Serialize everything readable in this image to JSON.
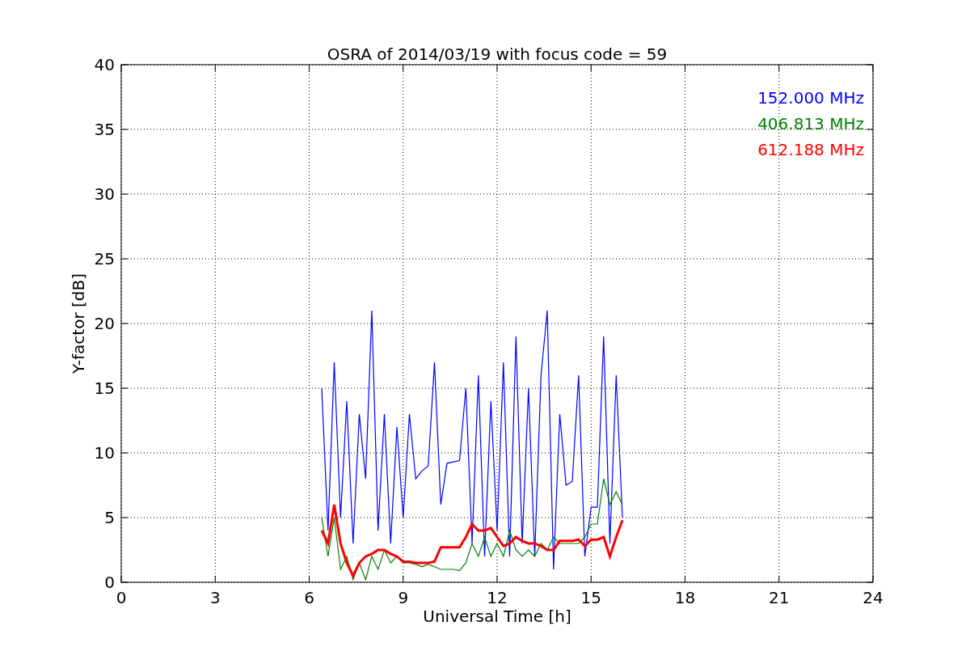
{
  "chart_data": {
    "type": "line",
    "title": "OSRA of 2014/03/19 with focus code = 59",
    "xlabel": "Universal Time [h]",
    "ylabel": "Y-factor [dB]",
    "x": [
      6.4,
      6.6,
      6.8,
      7.0,
      7.2,
      7.4,
      7.6,
      7.8,
      8.0,
      8.2,
      8.4,
      8.6,
      8.8,
      9.0,
      9.2,
      9.4,
      9.6,
      9.8,
      10.0,
      10.2,
      10.4,
      10.6,
      10.8,
      11.0,
      11.2,
      11.4,
      11.6,
      11.8,
      12.0,
      12.2,
      12.4,
      12.6,
      12.8,
      13.0,
      13.2,
      13.4,
      13.6,
      13.8,
      14.0,
      14.2,
      14.4,
      14.6,
      14.8,
      15.0,
      15.2,
      15.4,
      15.6,
      15.8,
      16.0
    ],
    "series": [
      {
        "name": "152.000 MHz",
        "color": "#0000ff",
        "values": [
          15,
          4,
          17,
          5,
          14,
          3,
          13,
          8,
          21,
          4,
          13,
          3,
          12,
          5,
          13,
          8,
          8.6,
          9,
          17,
          6,
          9.2,
          9.3,
          9.4,
          15,
          3,
          16,
          2,
          14,
          4,
          17,
          2,
          19,
          3,
          15,
          2,
          16,
          21,
          1,
          13,
          7.5,
          7.8,
          16,
          2,
          5.8,
          5.8,
          19,
          3,
          16,
          5
        ]
      },
      {
        "name": "406.813 MHz",
        "color": "#008000",
        "values": [
          5,
          2,
          5,
          1,
          2,
          0.2,
          1.5,
          0.2,
          2,
          1,
          2.5,
          1.5,
          2,
          1.5,
          1.5,
          1.4,
          1.2,
          1.4,
          1.2,
          1,
          1,
          1,
          0.9,
          1.5,
          3,
          2,
          3.5,
          2,
          3,
          2,
          4,
          2.5,
          2,
          2.5,
          2,
          3,
          2.5,
          3.5,
          3,
          3,
          3,
          3,
          3.5,
          4.5,
          4.5,
          8,
          6,
          7,
          6
        ]
      },
      {
        "name": "612.188 MHz",
        "color": "#ff0000",
        "values": [
          4,
          3,
          6,
          3,
          1.5,
          0.5,
          1.5,
          2,
          2.2,
          2.5,
          2.5,
          2.2,
          2,
          1.6,
          1.6,
          1.5,
          1.5,
          1.5,
          1.6,
          2.7,
          2.7,
          2.7,
          2.7,
          3.5,
          4.5,
          4,
          4,
          4.2,
          3.5,
          2.8,
          3,
          3.5,
          3.2,
          3,
          3,
          2.8,
          2.5,
          2.5,
          3.2,
          3.2,
          3.2,
          3.3,
          2.8,
          3.3,
          3.3,
          3.5,
          2,
          3.5,
          4.8
        ]
      }
    ],
    "xlim": [
      0,
      24
    ],
    "ylim": [
      0,
      40
    ],
    "xticks": [
      0,
      3,
      6,
      9,
      12,
      15,
      18,
      21,
      24
    ],
    "yticks": [
      0,
      5,
      10,
      15,
      20,
      25,
      30,
      35,
      40
    ],
    "grid": true
  }
}
